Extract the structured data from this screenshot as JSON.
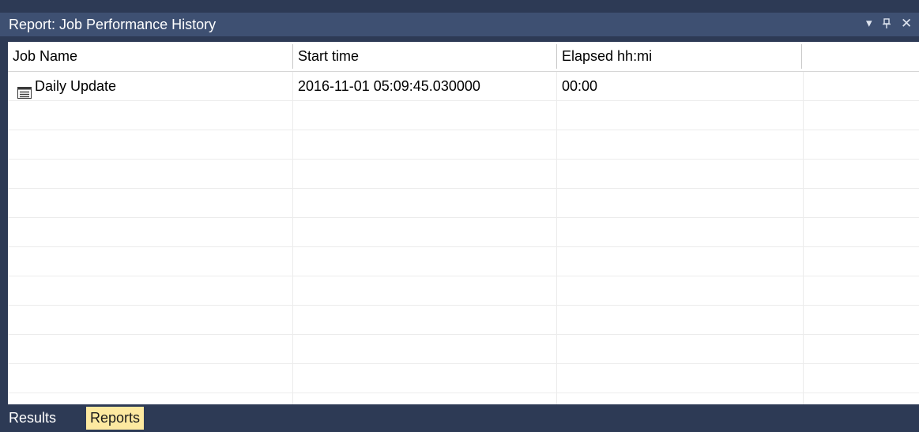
{
  "panel": {
    "title": "Report: Job Performance History",
    "controls": {
      "dropdown_glyph": "▾",
      "pin_glyph": "⊥",
      "close_glyph": "✕"
    }
  },
  "table": {
    "columns": [
      "Job Name",
      "Start time",
      "Elapsed hh:mi",
      ""
    ],
    "rows": [
      {
        "job_name": "Daily Update",
        "start_time": "2016-11-01 05:09:45.030000",
        "elapsed": "00:00",
        "icon": "job-list-icon"
      }
    ]
  },
  "tabs": [
    {
      "label": "Results",
      "active": false
    },
    {
      "label": "Reports",
      "active": true
    }
  ],
  "colors": {
    "title_bar": "#3e5072",
    "frame": "#2d3a55",
    "active_tab": "#fde9a0"
  }
}
